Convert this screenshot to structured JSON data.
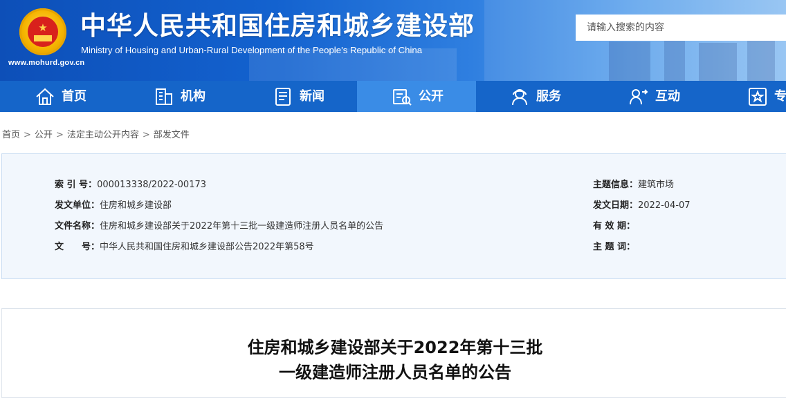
{
  "header": {
    "site_url": "www.mohurd.gov.cn",
    "title": "中华人民共和国住房和城乡建设部",
    "subtitle": "Ministry of Housing and Urban-Rural Development of the People’s Republic of China",
    "search_placeholder": "请输入搜索的内容",
    "emblem_icon": "national-emblem-icon"
  },
  "nav": {
    "items": [
      {
        "label": "首页",
        "icon": "home-icon"
      },
      {
        "label": "机构",
        "icon": "building-icon"
      },
      {
        "label": "新闻",
        "icon": "news-icon"
      },
      {
        "label": "公开",
        "icon": "document-icon",
        "active": true
      },
      {
        "label": "服务",
        "icon": "service-icon"
      },
      {
        "label": "互动",
        "icon": "interaction-icon"
      },
      {
        "label": "专",
        "icon": "topic-icon"
      }
    ]
  },
  "breadcrumb": [
    "首页",
    "公开",
    "法定主动公开内容",
    "部发文件"
  ],
  "info": {
    "index_label": "索 引 号：",
    "index_value": "000013338/2022-00173",
    "issuer_label": "发文单位：",
    "issuer_value": "住房和城乡建设部",
    "file_name_label": "文件名称：",
    "file_name_value": "住房和城乡建设部关于2022年第十三批一级建造师注册人员名单的公告",
    "doc_no_label": "文　　号：",
    "doc_no_value": "中华人民共和国住房和城乡建设部公告2022年第58号",
    "topic_label": "主题信息：",
    "topic_value": "建筑市场",
    "date_label": "发文日期：",
    "date_value": "2022-04-07",
    "validity_label": "有 效 期：",
    "validity_value": "",
    "keywords_label": "主 题 词：",
    "keywords_value": ""
  },
  "article": {
    "title_line1": "住房和城乡建设部关于2022年第十三批",
    "title_line2": "一级建造师注册人员名单的公告"
  },
  "colors": {
    "header_blue": "#1362cf",
    "nav_blue": "#1565c9",
    "nav_active": "#3a8ce6",
    "info_bg": "#f2f7fd"
  }
}
